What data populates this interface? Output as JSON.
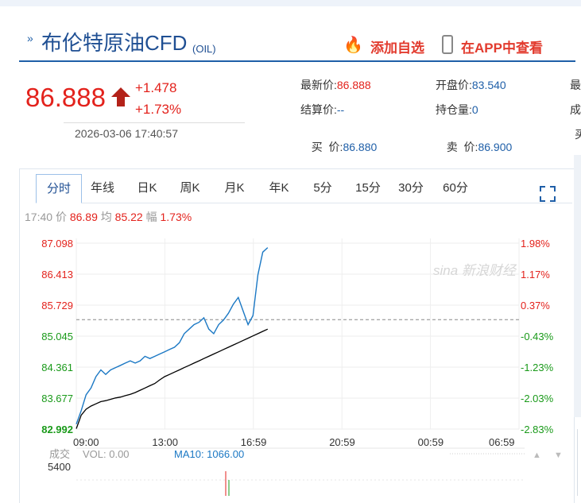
{
  "header": {
    "title": "布伦特原油CFD",
    "code": "(OIL)",
    "add_favorite": "添加自选",
    "view_in_app": "在APP中查看"
  },
  "quote": {
    "price": "86.888",
    "change": "+1.478",
    "change_pct": "+1.73%",
    "datetime": "2026-03-06 17:40:57"
  },
  "fields": {
    "latest_label": "最新价:",
    "latest_value": "86.888",
    "open_label": "开盘价:",
    "open_value": "83.540",
    "settle_label": "结算价:",
    "settle_value": "--",
    "position_label": "持仓量:",
    "position_value": "0",
    "bid_label": "买  价:",
    "bid_value": "86.880",
    "ask_label": "卖  价:",
    "ask_value": "86.900",
    "cut1": "最",
    "cut2": "成",
    "cut3": "买"
  },
  "tabs": [
    "分时",
    "年线",
    "日K",
    "周K",
    "月K",
    "年K",
    "5分",
    "15分",
    "30分",
    "60分"
  ],
  "info": {
    "time": "17:40",
    "price_label": "价",
    "price_value": "86.89",
    "avg_label": "均",
    "avg_value": "85.22",
    "amp_label": "幅",
    "amp_value": "1.73%"
  },
  "watermark": "sina 新浪财经",
  "volume": {
    "label": "成交",
    "vol_label": "VOL: 0.00",
    "ma10_label": "MA10: 1066.00",
    "ytick": "5400"
  },
  "colors": {
    "up": "#e3221c",
    "down": "#1a9a1a",
    "price_line": "#1b78c4",
    "avg_line": "#000000",
    "accent": "#1f4f93"
  },
  "chart_data": {
    "type": "line",
    "title": "",
    "xlabel": "",
    "ylabel": "",
    "prev_close": 85.41,
    "ylim": [
      82.992,
      87.098
    ],
    "yticks_left": [
      "87.098",
      "86.413",
      "85.729",
      "85.045",
      "84.361",
      "83.677",
      "82.992"
    ],
    "yticks_right": [
      "1.98%",
      "1.17%",
      "0.37%",
      "-0.43%",
      "-1.23%",
      "-2.03%",
      "-2.83%"
    ],
    "xticks": [
      "09:00",
      "13:00",
      "16:59",
      "20:59",
      "00:59",
      "06:59"
    ],
    "series": [
      {
        "values": [
          83.1,
          83.4,
          83.75,
          83.9,
          84.15,
          84.3,
          84.2,
          84.3,
          84.35,
          84.4,
          84.45,
          84.5,
          84.45,
          84.5,
          84.6,
          84.55,
          84.6,
          84.65,
          84.7,
          84.75,
          84.8,
          84.9,
          85.1,
          85.2,
          85.3,
          85.35,
          85.45,
          85.2,
          85.1,
          85.3,
          85.4,
          85.55,
          85.75,
          85.9,
          85.6,
          85.3,
          85.5,
          86.4,
          86.9,
          87.0
        ]
      },
      {
        "values": [
          83.0,
          83.3,
          83.43,
          83.5,
          83.55,
          83.6,
          83.62,
          83.65,
          83.68,
          83.7,
          83.73,
          83.76,
          83.8,
          83.85,
          83.9,
          83.95,
          84.0,
          84.08,
          84.15,
          84.2,
          84.25,
          84.3,
          84.35,
          84.4,
          84.45,
          84.5,
          84.55,
          84.6,
          84.65,
          84.7,
          84.75,
          84.8,
          84.85,
          84.9,
          84.95,
          85.0,
          85.05,
          85.1,
          85.15,
          85.2
        ]
      }
    ]
  }
}
